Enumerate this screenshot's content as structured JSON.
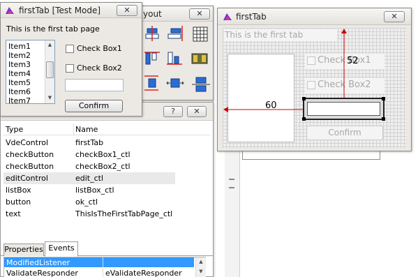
{
  "colors": {
    "window_bg": "#ece9e4",
    "selection_blue": "#3399ff",
    "guide_red": "#cc0000",
    "grid_bg": "#efefef"
  },
  "left_window": {
    "title": "firstTab [Test Mode]",
    "close_icon": "close-icon",
    "label": "This is the first tab page",
    "list_items": [
      "Item1",
      "Item2",
      "Item3",
      "Item4",
      "Item5",
      "Item6",
      "Item7"
    ],
    "checkbox1_label": "Check Box1",
    "checkbox2_label": "Check Box2",
    "edit_value": "",
    "confirm_label": "Confirm"
  },
  "layout_panel": {
    "title_fragment": "yout",
    "close_icon": "close-icon",
    "tools": [
      "align-left-center-icon",
      "align-right-edge-icon",
      "grid-table-icon",
      "align-top-icon",
      "align-bottom-icon",
      "distribute-horizontal-icon",
      "resize-vertical-icon",
      "expand-horizontal-icon",
      "compress-vertical-icon"
    ]
  },
  "properties_panel": {
    "help_label": "?",
    "close_label": "✕",
    "columns": [
      "Type",
      "Name"
    ],
    "rows": [
      {
        "type": "VdeControl",
        "name": "firstTab"
      },
      {
        "type": "checkButton",
        "name": "checkBox1_ctl"
      },
      {
        "type": "checkButton",
        "name": "checkBox2_ctl"
      },
      {
        "type": "editControl",
        "name": "edit_ctl"
      },
      {
        "type": "listBox",
        "name": "listBox_ctl"
      },
      {
        "type": "button",
        "name": "ok_ctl"
      },
      {
        "type": "text",
        "name": "ThisIsTheFirstTabPage_ctl"
      }
    ],
    "tabs": [
      "Properties",
      "Events"
    ],
    "active_tab": "Events",
    "events": [
      {
        "event": "ModifiedListener",
        "handler": ""
      },
      {
        "event": "ValidateResponder",
        "handler": "eValidateResponder"
      }
    ]
  },
  "design_window": {
    "title": "firstTab",
    "label_ghost": "This is the first tab",
    "checkbox1_ghost": "Check Box1",
    "checkbox2_ghost": "Check Box2",
    "confirm_ghost": "Confirm",
    "measure_horizontal": "60",
    "measure_vertical": "52"
  }
}
